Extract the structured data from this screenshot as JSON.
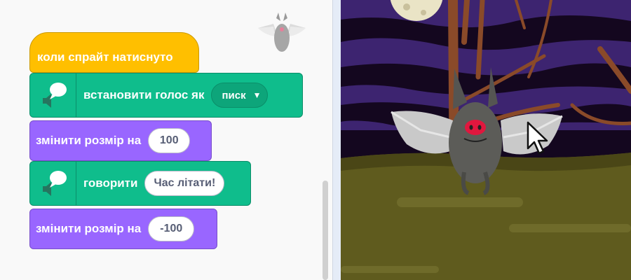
{
  "blocks": {
    "hat_label": "коли спрайт натиснуто",
    "set_voice_label": "встановити голос як",
    "voice_value": "писк",
    "change_size_label_1": "змінити розмір на",
    "change_size_value_1": "100",
    "speak_label": "говорити",
    "speak_value": "Час літати!",
    "change_size_label_2": "змінити розмір на",
    "change_size_value_2": "-100"
  },
  "colors": {
    "events": "#ffbf00",
    "text2speech": "#0fbd8c",
    "looks": "#9966ff",
    "sky": "#3d2470",
    "ground": "#5f5b1e"
  },
  "icons": [
    "sprite-thumbnail-bat",
    "speaker-icon",
    "speech-bubble-icon",
    "dropdown-caret-icon",
    "mouse-pointer-icon"
  ]
}
